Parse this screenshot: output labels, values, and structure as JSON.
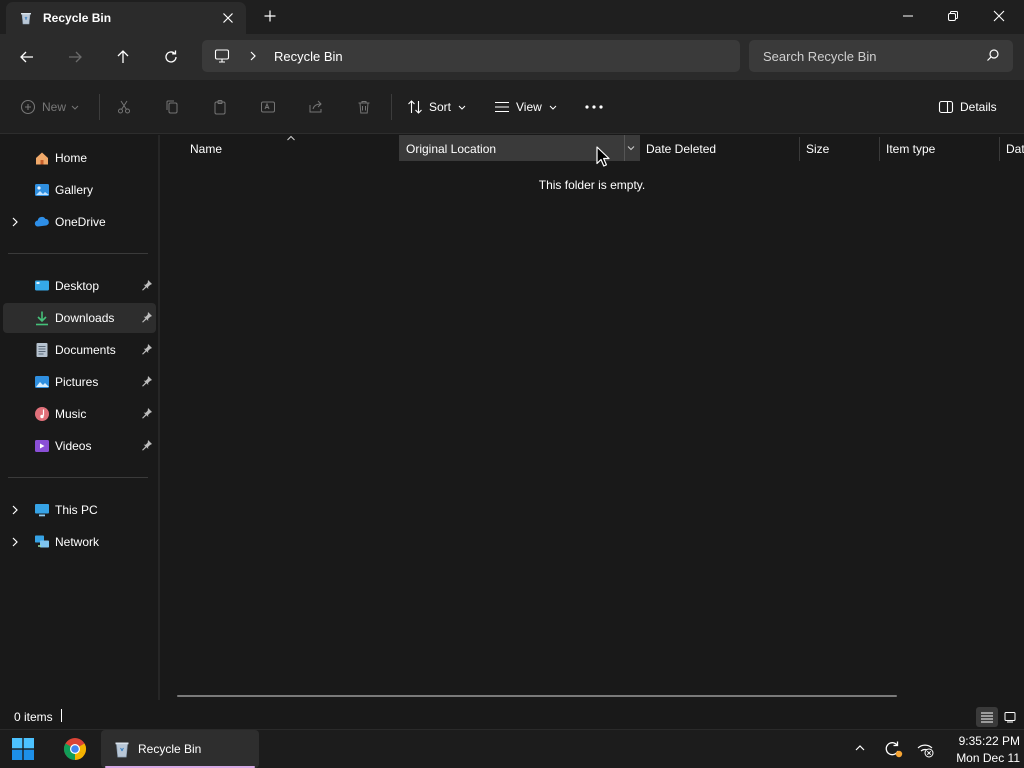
{
  "window": {
    "tab_title": "Recycle Bin"
  },
  "address": {
    "location": "Recycle Bin",
    "search_placeholder": "Search Recycle Bin"
  },
  "commands": {
    "new_label": "New",
    "sort_label": "Sort",
    "view_label": "View",
    "details_label": "Details"
  },
  "sidebar": {
    "items": [
      {
        "label": "Home",
        "icon": "home-icon"
      },
      {
        "label": "Gallery",
        "icon": "gallery-icon"
      },
      {
        "label": "OneDrive",
        "icon": "onedrive-icon"
      },
      {
        "label": "Desktop",
        "icon": "desktop-icon"
      },
      {
        "label": "Downloads",
        "icon": "downloads-icon",
        "selected": true
      },
      {
        "label": "Documents",
        "icon": "documents-icon"
      },
      {
        "label": "Pictures",
        "icon": "pictures-icon"
      },
      {
        "label": "Music",
        "icon": "music-icon"
      },
      {
        "label": "Videos",
        "icon": "videos-icon"
      },
      {
        "label": "This PC",
        "icon": "this-pc-icon"
      },
      {
        "label": "Network",
        "icon": "network-icon"
      }
    ]
  },
  "columns": [
    "Name",
    "Original Location",
    "Date Deleted",
    "Size",
    "Item type",
    "Dat"
  ],
  "main": {
    "empty_message": "This folder is empty."
  },
  "status": {
    "item_count": "0 items"
  },
  "taskbar": {
    "app_label": "Recycle Bin",
    "time": "9:35:22 PM",
    "date": "Mon Dec 11"
  },
  "colors": {
    "background": "#191919",
    "toolbar": "#202020",
    "address_bar": "#2b2b2b",
    "accent_folder": "#0078d4"
  }
}
